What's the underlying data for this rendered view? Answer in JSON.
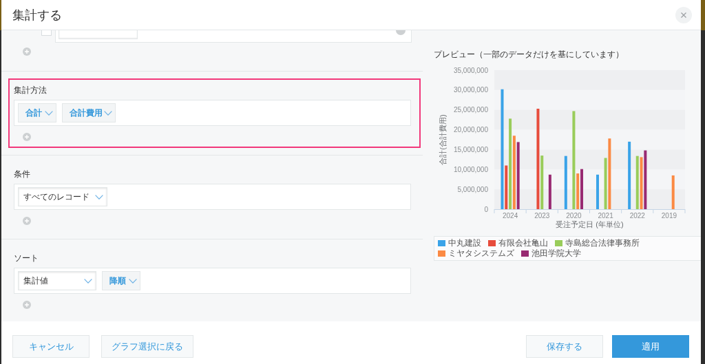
{
  "dialog": {
    "title": "集計する"
  },
  "sections": [
    {
      "label": "集計方法",
      "highlighted": true,
      "selects": [
        {
          "kind": "button",
          "value": "合計"
        },
        {
          "kind": "button",
          "value": "合計費用"
        }
      ]
    },
    {
      "label": "条件",
      "highlighted": false,
      "selects": [
        {
          "kind": "field",
          "value": "すべてのレコード"
        }
      ]
    },
    {
      "label": "ソート",
      "highlighted": false,
      "selects": [
        {
          "kind": "field",
          "value": "集計値"
        },
        {
          "kind": "button",
          "value": "降順"
        }
      ]
    }
  ],
  "preview": {
    "title": "プレビュー（一部のデータだけを基にしています）",
    "chart_data": {
      "type": "bar",
      "xlabel": "受注予定日 (年単位)",
      "ylabel": "合計(合計費用)",
      "categories": [
        "2024",
        "2023",
        "2020",
        "2021",
        "2022",
        "2019"
      ],
      "ylim": [
        0,
        35000000
      ],
      "yticks": [
        {
          "value": 0,
          "label": "0"
        },
        {
          "value": 5000000,
          "label": "5,000,000"
        },
        {
          "value": 10000000,
          "label": "10,000,000"
        },
        {
          "value": 15000000,
          "label": "15,000,000"
        },
        {
          "value": 20000000,
          "label": "20,000,000"
        },
        {
          "value": 25000000,
          "label": "25,000,000"
        },
        {
          "value": 30000000,
          "label": "30,000,000"
        },
        {
          "value": 35000000,
          "label": "35,000,000"
        }
      ],
      "series": [
        {
          "name": "中丸建設",
          "color": "#3aa3e8",
          "values": [
            30200000,
            null,
            13400000,
            8700000,
            17000000,
            null
          ]
        },
        {
          "name": "有限会社亀山",
          "color": "#e74c3c",
          "values": [
            11000000,
            25300000,
            null,
            null,
            null,
            null
          ]
        },
        {
          "name": "寺島総合法律事務所",
          "color": "#99cc5a",
          "values": [
            22800000,
            13500000,
            24700000,
            12900000,
            13400000,
            null
          ]
        },
        {
          "name": "ミヤタシステムズ",
          "color": "#fb8a44",
          "values": [
            18500000,
            null,
            9000000,
            17800000,
            13100000,
            8500000
          ]
        },
        {
          "name": "池田学院大学",
          "color": "#982a72",
          "values": [
            16900000,
            8700000,
            10100000,
            null,
            14800000,
            null
          ]
        }
      ]
    }
  },
  "footer": {
    "left": [
      {
        "label": "キャンセル",
        "kind": "secondary"
      },
      {
        "label": "グラフ選択に戻る",
        "kind": "secondary"
      }
    ],
    "right": [
      {
        "label": "保存する",
        "kind": "secondary"
      },
      {
        "label": "適用",
        "kind": "primary"
      }
    ]
  }
}
